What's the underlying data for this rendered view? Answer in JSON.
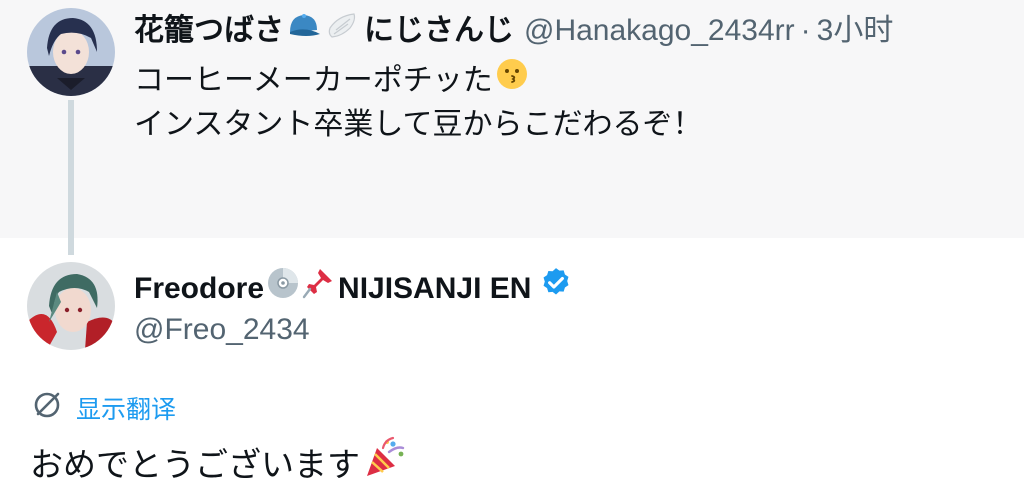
{
  "parent_tweet": {
    "author_name": "花籠つばさ",
    "author_name_suffix": "にじさんじ",
    "author_handle": "@Hanakago_2434rr",
    "separator": "·",
    "timestamp": "3小时",
    "text_line1": "コーヒーメーカーポチッた",
    "text_line2": "インスタント卒業して豆からこだわるぞ！",
    "name_emojis": [
      "blue-cap-icon",
      "white-wing-icon"
    ],
    "text_emoji": "kissing-face-icon"
  },
  "reply_tweet": {
    "author_name": "Freodore",
    "author_name_suffix": "NIJISANJI EN",
    "author_handle": "@Freo_2434",
    "name_emojis": [
      "cd-icon",
      "pushpin-icon",
      "verified-badge-icon"
    ],
    "translate_label": "显示翻译",
    "text": "おめでとうございます",
    "text_emoji": "party-popper-icon"
  },
  "colors": {
    "link_blue": "#1d9bf0",
    "secondary_text": "#536471",
    "primary_text": "#0f1419",
    "parent_background": "#f7f7f8",
    "thread_line": "#cfd9de"
  }
}
